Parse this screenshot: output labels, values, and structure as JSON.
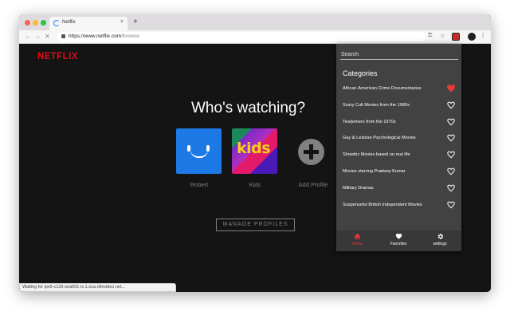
{
  "browser": {
    "tab_title": "Netflix",
    "tab_close": "×",
    "new_tab": "+",
    "url_host": "https://www.netflix.com",
    "url_path": "/browse",
    "status_text": "Waiting for ipv6-c125-sea001-ix.1.oca.nflxvideo.net..."
  },
  "netflix": {
    "logo": "NETFLIX",
    "heading": "Who's watching?",
    "profiles": [
      {
        "name": "Robert"
      },
      {
        "name": "Kids",
        "avatar_text": "kids"
      },
      {
        "name": "Add Profile"
      }
    ],
    "manage_button": "MANAGE PROFILES"
  },
  "extension": {
    "search_placeholder": "Search",
    "categories_title": "Categories",
    "categories": [
      {
        "label": "African-American Crime Documentaries",
        "favorite": true
      },
      {
        "label": "Scary Cult Movies from the 1980s",
        "favorite": false
      },
      {
        "label": "Tearjerkers from the 1970s",
        "favorite": false
      },
      {
        "label": "Gay & Lesbian Psychological Movies",
        "favorite": false
      },
      {
        "label": "Showbiz Movies based on real life",
        "favorite": false
      },
      {
        "label": "Movies starring Pradeep Kumar",
        "favorite": false
      },
      {
        "label": "Military Dramas",
        "favorite": false
      },
      {
        "label": "Suspenseful British Independent Movies",
        "favorite": false
      }
    ],
    "nav": {
      "home": "Home",
      "favorites": "Favorites",
      "settings": "settings"
    },
    "colors": {
      "active": "#e53935",
      "panel": "#424242"
    }
  }
}
